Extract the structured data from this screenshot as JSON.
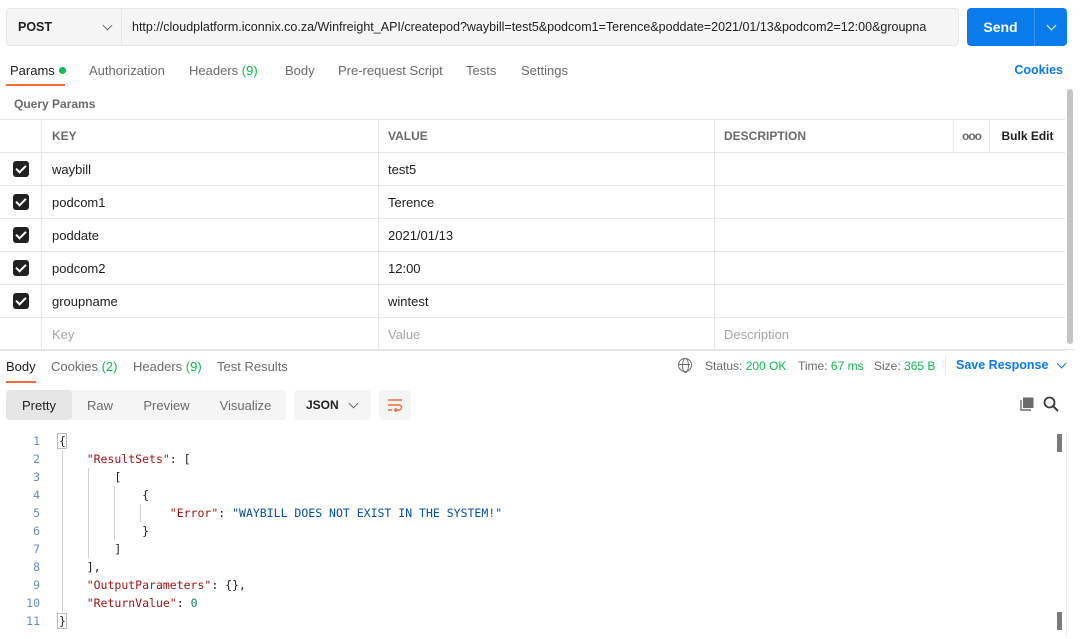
{
  "request": {
    "method": "POST",
    "url": "http://cloudplatform.iconnix.co.za/Winfreight_API/createpod?waybill=test5&podcom1=Terence&poddate=2021/01/13&podcom2=12:00&groupna",
    "send_label": "Send"
  },
  "request_tabs": [
    {
      "label": "Params",
      "count": ""
    },
    {
      "label": "Authorization",
      "count": ""
    },
    {
      "label": "Headers",
      "count": "(9)"
    },
    {
      "label": "Body",
      "count": ""
    },
    {
      "label": "Pre-request Script",
      "count": ""
    },
    {
      "label": "Tests",
      "count": ""
    },
    {
      "label": "Settings",
      "count": ""
    }
  ],
  "cookies_link": "Cookies",
  "query_params": {
    "title": "Query Params",
    "headers": {
      "key": "KEY",
      "value": "VALUE",
      "description": "DESCRIPTION",
      "more": "ooo",
      "bulk_edit": "Bulk Edit"
    },
    "rows": [
      {
        "key": "waybill",
        "value": "test5",
        "description": ""
      },
      {
        "key": "podcom1",
        "value": "Terence",
        "description": ""
      },
      {
        "key": "poddate",
        "value": "2021/01/13",
        "description": ""
      },
      {
        "key": "podcom2",
        "value": "12:00",
        "description": ""
      },
      {
        "key": "groupname",
        "value": "wintest",
        "description": ""
      }
    ],
    "placeholders": {
      "key": "Key",
      "value": "Value",
      "description": "Description"
    }
  },
  "response_tabs": [
    {
      "label": "Body",
      "count": ""
    },
    {
      "label": "Cookies",
      "count": "(2)"
    },
    {
      "label": "Headers",
      "count": "(9)"
    },
    {
      "label": "Test Results",
      "count": ""
    }
  ],
  "response_status": {
    "status_label": "Status:",
    "status_value": "200 OK",
    "time_label": "Time:",
    "time_value": "67 ms",
    "size_label": "Size:",
    "size_value": "365 B",
    "save_label": "Save Response"
  },
  "view": {
    "modes": [
      "Pretty",
      "Raw",
      "Preview",
      "Visualize"
    ],
    "format": "JSON"
  },
  "code_lines": [
    "1",
    "2",
    "3",
    "4",
    "5",
    "6",
    "7",
    "8",
    "9",
    "10",
    "11"
  ],
  "code": {
    "result_sets_key": "\"ResultSets\"",
    "error_key": "\"Error\"",
    "error_value": "\"WAYBILL DOES NOT EXIST IN THE SYSTEM!\"",
    "output_key": "\"OutputParameters\"",
    "return_key": "\"ReturnValue\"",
    "return_value": "0"
  },
  "colors": {
    "accent": "#097bed",
    "tab_underline": "#f26b3a",
    "success": "#0cbb52"
  }
}
